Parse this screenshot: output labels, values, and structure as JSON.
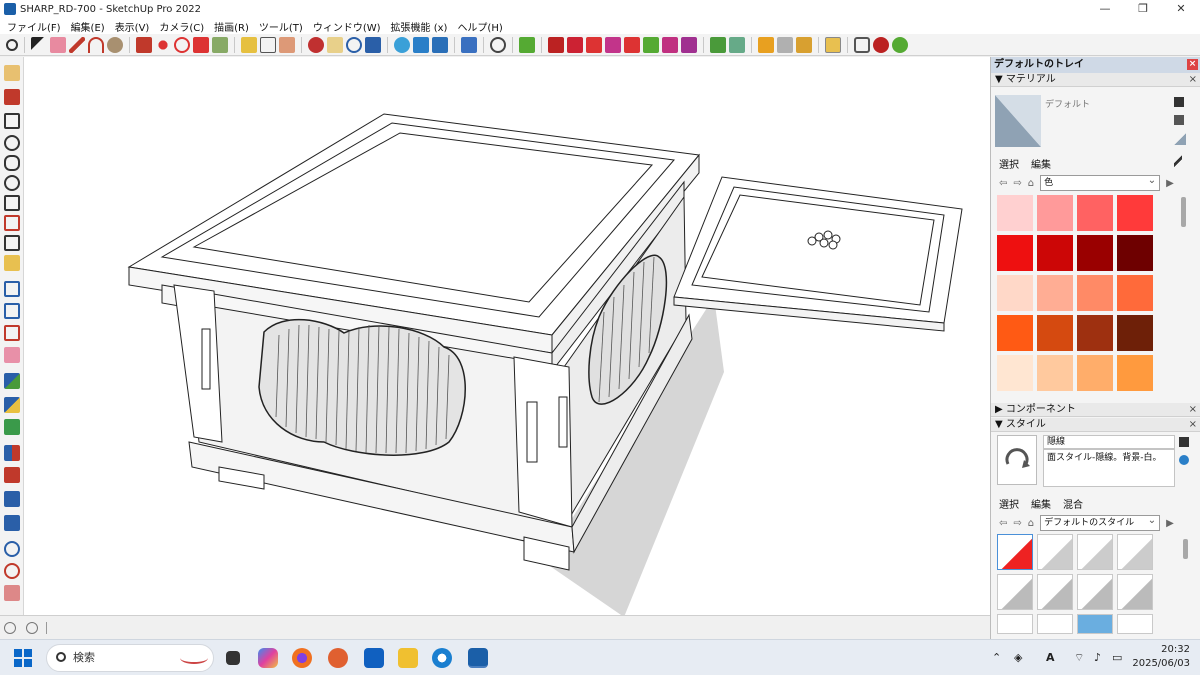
{
  "window": {
    "title": "SHARP_RD-700 - SketchUp Pro 2022"
  },
  "menu": [
    "ファイル(F)",
    "編集(E)",
    "表示(V)",
    "カメラ(C)",
    "描画(R)",
    "ツール(T)",
    "ウィンドウ(W)",
    "拡張機能 (x)",
    "ヘルプ(H)"
  ],
  "tray": {
    "title": "デフォルトのトレイ",
    "materials": {
      "header": "マテリアル",
      "name": "デフォルト",
      "tabs": [
        "選択",
        "編集"
      ],
      "category": "色",
      "swatches": [
        "#ffd0d0",
        "#ff9a9a",
        "#ff6262",
        "#ff3a3a",
        "#ee1010",
        "#cc0606",
        "#9a0000",
        "#6e0000",
        "#ffd8c8",
        "#ffad94",
        "#ff8a66",
        "#ff6a3a",
        "#ff5a14",
        "#d54a10",
        "#9e3010",
        "#6e2008",
        "#ffe6d2",
        "#ffc99e",
        "#ffad6a",
        "#ff9a3e"
      ]
    },
    "components": {
      "header": "コンポーネント"
    },
    "styles": {
      "header": "スタイル",
      "name": "隠線",
      "description": "面スタイル-隠線。背景-白。",
      "tabs": [
        "選択",
        "編集",
        "混合"
      ],
      "collection": "デフォルトのスタイル"
    }
  },
  "taskbar": {
    "search_placeholder": "検索",
    "time": "20:32",
    "date": "2025/06/03"
  },
  "colors": {
    "titlebar": "#ffffff",
    "tray_header": "#cfd9e6",
    "accent": "#0a67c8"
  },
  "icons": {
    "toolbar": [
      "search-icon",
      "select-icon",
      "eraser-icon",
      "pencil-icon",
      "arc-icon",
      "paint-bucket-icon",
      "push-pull-icon",
      "move-icon",
      "rotate-icon",
      "scale-icon",
      "tape-measure-icon",
      "text-icon",
      "orbit-icon",
      "pan-icon",
      "zoom-icon",
      "zoom-extents-icon",
      "section-icon",
      "layer-icon",
      "warehouse-icon",
      "extension-warehouse-icon",
      "sandbox-icon",
      "solid-tools-icon",
      "outer-shell-icon",
      "union-icon",
      "subtract-icon",
      "trim-icon",
      "split-icon",
      "materials-icon",
      "components-icon",
      "styles-icon",
      "tags-icon",
      "scenes-icon",
      "shadows-icon",
      "fog-icon",
      "match-photo-icon"
    ],
    "left": [
      "pencil-tool-icon",
      "line-tool-icon",
      "rectangle-icon",
      "circle-icon",
      "polygon-icon",
      "arc-tool-icon",
      "offset-icon",
      "follow-me-icon",
      "tape-icon",
      "protractor-icon",
      "axes-icon",
      "dimension-icon",
      "text-tool-icon",
      "3d-text-icon",
      "walk-icon",
      "look-around-icon",
      "position-camera-icon",
      "section-plane-icon",
      "orbit-tool-icon",
      "pan-tool-icon",
      "zoom-tool-icon",
      "zoom-window-icon",
      "previous-view-icon",
      "next-view-icon"
    ]
  }
}
